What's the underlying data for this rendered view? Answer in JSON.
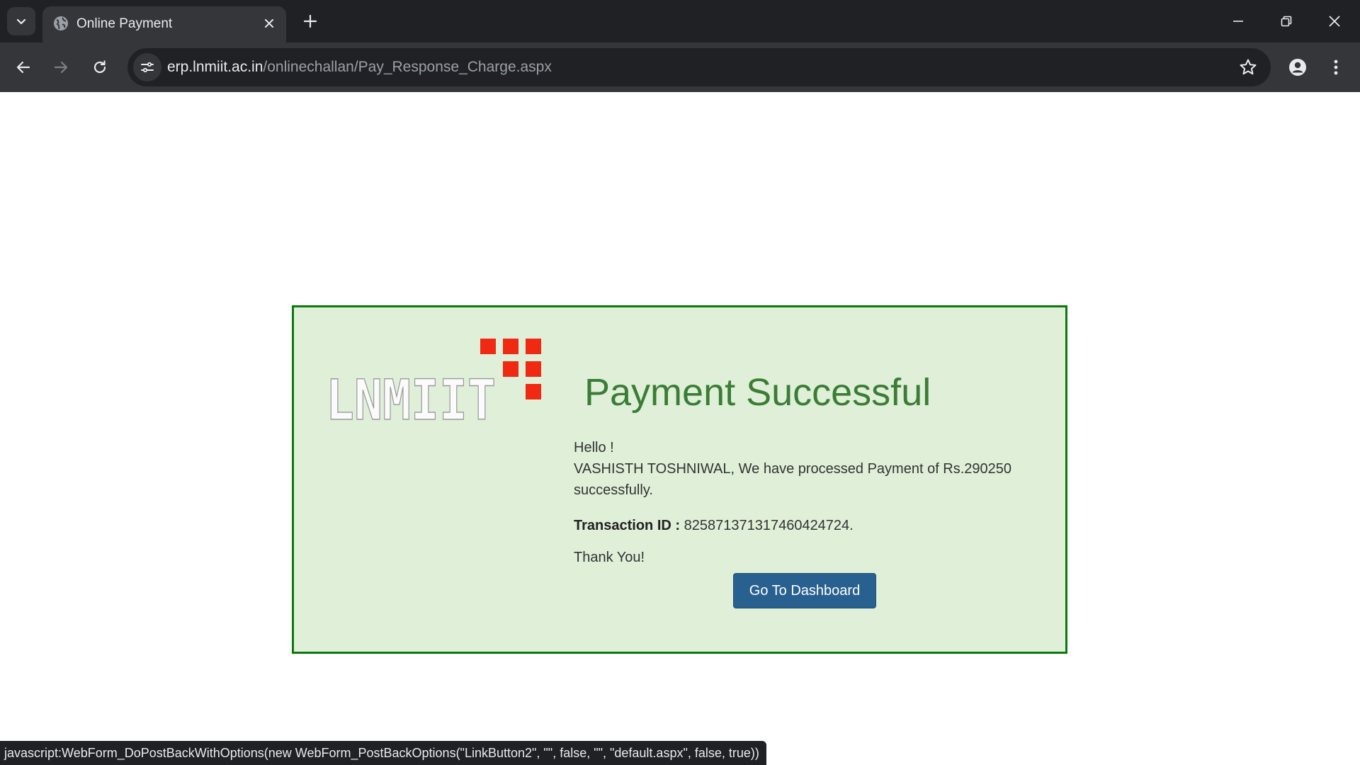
{
  "browser": {
    "tab": {
      "title": "Online Payment"
    },
    "address_bar": {
      "host": "erp.lnmiit.ac.in",
      "path": "/onlinechallan/Pay_Response_Charge.aspx"
    },
    "icons": {
      "tab_search": "chevron-down-icon",
      "favicon": "globe-icon",
      "tab_close": "close-icon",
      "new_tab": "plus-icon",
      "minimize": "minimize-icon",
      "restore": "restore-icon",
      "window_close": "close-icon",
      "back": "arrow-left-icon",
      "forward": "arrow-right-icon",
      "reload": "reload-icon",
      "site_info": "tune-icon",
      "bookmark": "star-icon",
      "profile": "person-icon",
      "menu": "kebab-icon"
    },
    "status_text": "javascript:WebForm_DoPostBackWithOptions(new WebForm_PostBackOptions(\"LinkButton2\", \"\", false, \"\", \"default.aspx\", false, true))"
  },
  "page": {
    "logo_text": "LNMIIT",
    "title": "Payment Successful",
    "greeting": "Hello !",
    "message": "VASHISTH TOSHNIWAL, We have processed Payment of Rs.290250 successfully.",
    "transaction_label": "Transaction ID :",
    "transaction_value": "825871371317460424724.",
    "thanks": "Thank You!",
    "dashboard_button": "Go To Dashboard"
  },
  "colors": {
    "card_bg": "#dfefd8",
    "card_border": "#0b7a0b",
    "title": "#3a7d34",
    "button": "#286090",
    "logo_squares": "#f02a12"
  }
}
